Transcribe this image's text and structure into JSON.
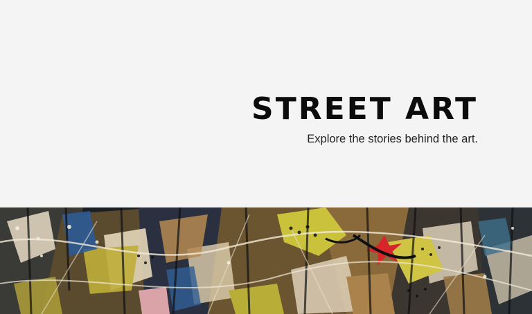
{
  "hero": {
    "title": "STREET ART",
    "subtitle": "Explore the stories behind the art."
  },
  "banner": {
    "image": "street-art-graffiti-collage",
    "colors": {
      "dark": "#1c1f22",
      "yellow": "#c9c23a",
      "cream": "#e8dcc4",
      "tan": "#b58a52",
      "red": "#d8252a",
      "blue": "#2a5a9a",
      "pink": "#d9a3a8"
    }
  }
}
